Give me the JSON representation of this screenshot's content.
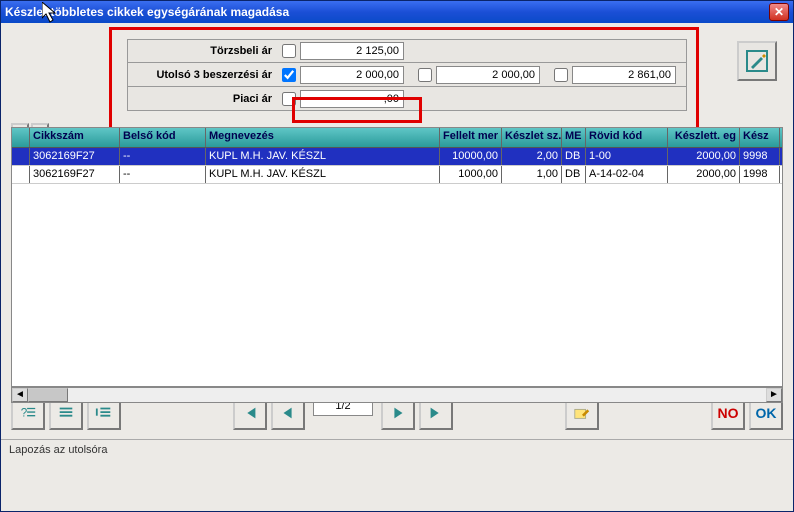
{
  "window": {
    "title": "Készlet többletes cikkek egységárának magadása"
  },
  "prices": {
    "torz_label": "Törzsbeli ár",
    "torz_checked": false,
    "torz_value": "2 125,00",
    "utolso_label": "Utolsó 3 beszerzési ár",
    "utolso_checked": true,
    "utolso_value": "2 000,00",
    "utolso_v2_checked": false,
    "utolso_v2": "2 000,00",
    "utolso_v3_checked": false,
    "utolso_v3": "2 861,00",
    "piaci_label": "Piaci ár",
    "piaci_checked": false,
    "piaci_value": ",00"
  },
  "columns": {
    "cikk": "Cikkszám",
    "belso": "Belső kód",
    "megn": "Megnevezés",
    "fel": "Fellelt mer",
    "kesz": "Készlet sz.",
    "me": "ME",
    "rov": "Rövid kód",
    "kegy": "Készlett. eg",
    "last": "Kész"
  },
  "rows": [
    {
      "cikk": "3062169F27",
      "belso": "--",
      "megn": "KUPL M.H. JAV. KÉSZL",
      "fel": "10000,00",
      "kesz": "2,00",
      "me": "DB",
      "rov": "1-00",
      "kegy": "2000,00",
      "last": "9998"
    },
    {
      "cikk": "3062169F27",
      "belso": "--",
      "megn": "KUPL M.H. JAV. KÉSZL",
      "fel": "1000,00",
      "kesz": "1,00",
      "me": "DB",
      "rov": "A-14-02-04",
      "kegy": "2000,00",
      "last": "1998"
    }
  ],
  "pager": {
    "text": "1/2"
  },
  "status": {
    "text": "Lapozás az utolsóra"
  },
  "buttons": {
    "no": "NO",
    "ok": "OK",
    "plus": "+",
    "minus": "−"
  }
}
